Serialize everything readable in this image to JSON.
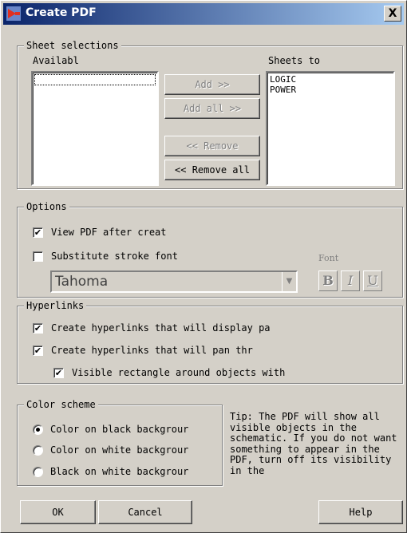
{
  "window": {
    "title": "Create PDF",
    "close_label": "X"
  },
  "sheet_selections": {
    "legend": "Sheet selections",
    "available_label": "Availabl",
    "sheets_to_label": "Sheets to",
    "available_items": [],
    "sheets_to_items": [
      "LOGIC",
      "POWER"
    ],
    "add_label": "Add >>",
    "add_all_label": "Add all >>",
    "remove_label": "<< Remove",
    "remove_all_label": "<< Remove all"
  },
  "options": {
    "legend": "Options",
    "view_pdf_label": "View PDF after creat",
    "view_pdf_checked": true,
    "substitute_label": "Substitute stroke font",
    "substitute_checked": false,
    "font_label": "Font",
    "font_value": "Tahoma",
    "bold_label": "B",
    "italic_label": "I",
    "underline_label": "U"
  },
  "hyperlinks": {
    "legend": "Hyperlinks",
    "display_label": "Create hyperlinks that will display pa",
    "display_checked": true,
    "pan_label": "Create hyperlinks that will pan thr",
    "pan_checked": true,
    "rect_label": "Visible rectangle around objects with",
    "rect_checked": true
  },
  "color_scheme": {
    "legend": "Color scheme",
    "options": [
      {
        "label": "Color on black backgrour",
        "selected": true
      },
      {
        "label": "Color on white backgrour",
        "selected": false
      },
      {
        "label": "Black on white backgrour",
        "selected": false
      }
    ]
  },
  "tip": "Tip: The PDF will show all visible objects in the schematic. If you do not want something to appear in the PDF, turn off its visibility in the",
  "buttons": {
    "ok": "OK",
    "cancel": "Cancel",
    "help": "Help"
  },
  "colors": {
    "title_start": "#0a246a",
    "title_end": "#a6caf0",
    "face": "#d4d0c8",
    "disabled_text": "#808080"
  }
}
